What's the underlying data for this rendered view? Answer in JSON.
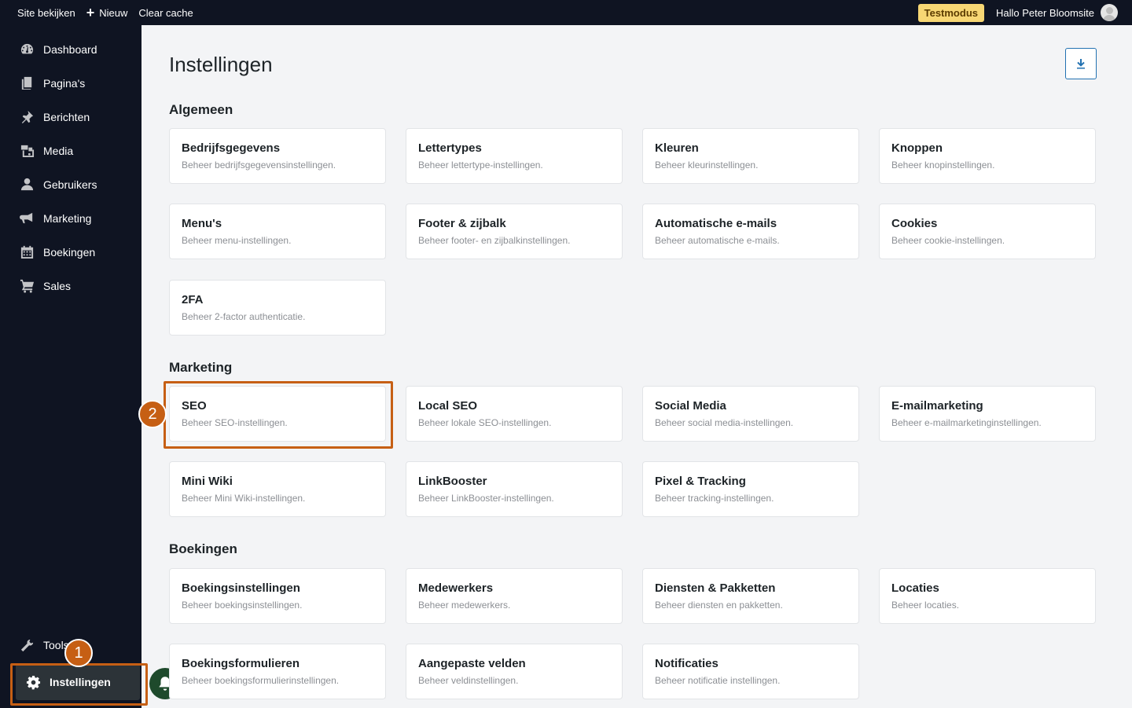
{
  "topbar": {
    "view_site": "Site bekijken",
    "new_label": "Nieuw",
    "clear_cache": "Clear cache",
    "test_mode": "Testmodus",
    "greeting": "Hallo Peter Bloomsite"
  },
  "sidebar": {
    "items": [
      {
        "label": "Dashboard",
        "icon": "dashboard-icon"
      },
      {
        "label": "Pagina's",
        "icon": "pages-icon"
      },
      {
        "label": "Berichten",
        "icon": "pin-icon"
      },
      {
        "label": "Media",
        "icon": "media-icon"
      },
      {
        "label": "Gebruikers",
        "icon": "users-icon"
      },
      {
        "label": "Marketing",
        "icon": "megaphone-icon"
      },
      {
        "label": "Boekingen",
        "icon": "calendar-icon"
      },
      {
        "label": "Sales",
        "icon": "cart-icon"
      }
    ],
    "tools_label": "Tools",
    "settings_label": "Instellingen"
  },
  "steps": {
    "one": "1",
    "two": "2"
  },
  "main": {
    "title": "Instellingen",
    "sections": [
      {
        "title": "Algemeen",
        "cards": [
          {
            "title": "Bedrijfsgegevens",
            "desc": "Beheer bedrijfsgegevensinstellingen."
          },
          {
            "title": "Lettertypes",
            "desc": "Beheer lettertype-instellingen."
          },
          {
            "title": "Kleuren",
            "desc": "Beheer kleurinstellingen."
          },
          {
            "title": "Knoppen",
            "desc": "Beheer knopinstellingen."
          },
          {
            "title": "Menu's",
            "desc": "Beheer menu-instellingen."
          },
          {
            "title": "Footer & zijbalk",
            "desc": "Beheer footer- en zijbalkinstellingen."
          },
          {
            "title": "Automatische e-mails",
            "desc": "Beheer automatische e-mails."
          },
          {
            "title": "Cookies",
            "desc": "Beheer cookie-instellingen."
          },
          {
            "title": "2FA",
            "desc": "Beheer 2-factor authenticatie."
          }
        ]
      },
      {
        "title": "Marketing",
        "cards": [
          {
            "title": "SEO",
            "desc": "Beheer SEO-instellingen."
          },
          {
            "title": "Local SEO",
            "desc": "Beheer lokale SEO-instellingen."
          },
          {
            "title": "Social Media",
            "desc": "Beheer social media-instellingen."
          },
          {
            "title": "E-mailmarketing",
            "desc": "Beheer e-mailmarketinginstellingen."
          },
          {
            "title": "Mini Wiki",
            "desc": "Beheer Mini Wiki-instellingen."
          },
          {
            "title": "LinkBooster",
            "desc": "Beheer LinkBooster-instellingen."
          },
          {
            "title": "Pixel & Tracking",
            "desc": "Beheer tracking-instellingen."
          }
        ]
      },
      {
        "title": "Boekingen",
        "cards": [
          {
            "title": "Boekingsinstellingen",
            "desc": "Beheer boekingsinstellingen."
          },
          {
            "title": "Medewerkers",
            "desc": "Beheer medewerkers."
          },
          {
            "title": "Diensten & Pakketten",
            "desc": "Beheer diensten en pakketten."
          },
          {
            "title": "Locaties",
            "desc": "Beheer locaties."
          },
          {
            "title": "Boekingsformulieren",
            "desc": "Beheer boekingsformulierinstellingen."
          },
          {
            "title": "Aangepaste velden",
            "desc": "Beheer veldinstellingen."
          },
          {
            "title": "Notificaties",
            "desc": "Beheer notificatie instellingen."
          }
        ]
      }
    ]
  },
  "colors": {
    "sidebar_bg": "#0f1422",
    "highlight": "#c65f14",
    "test_badge": "#f7d774",
    "accent": "#2271b1"
  }
}
